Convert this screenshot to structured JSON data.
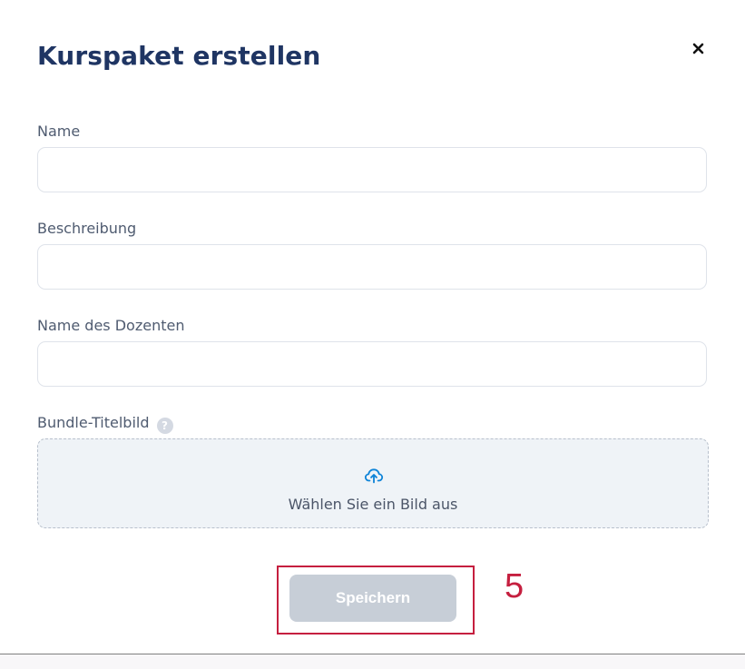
{
  "dialog": {
    "title": "Kurspaket erstellen",
    "close_icon": "close-icon",
    "fields": {
      "name": {
        "label": "Name",
        "value": "",
        "placeholder": ""
      },
      "description": {
        "label": "Beschreibung",
        "value": "",
        "placeholder": ""
      },
      "instructor": {
        "label": "Name des Dozenten",
        "value": "",
        "placeholder": ""
      },
      "cover": {
        "label": "Bundle-Titelbild",
        "help_icon": "help-icon",
        "help_glyph": "?",
        "upload_icon": "cloud-upload-icon",
        "upload_text": "Wählen Sie ein Bild aus"
      }
    },
    "save_button": {
      "label": "Speichern",
      "state": "disabled"
    },
    "annotation": {
      "label": "5",
      "color": "#c51f3f"
    }
  },
  "colors": {
    "title": "#1f3563",
    "label": "#4f5b70",
    "input_border": "#dfe3ea",
    "upload_background": "#eff3f7",
    "upload_icon": "#0f84d8",
    "disabled_button": "#c7ced7"
  }
}
